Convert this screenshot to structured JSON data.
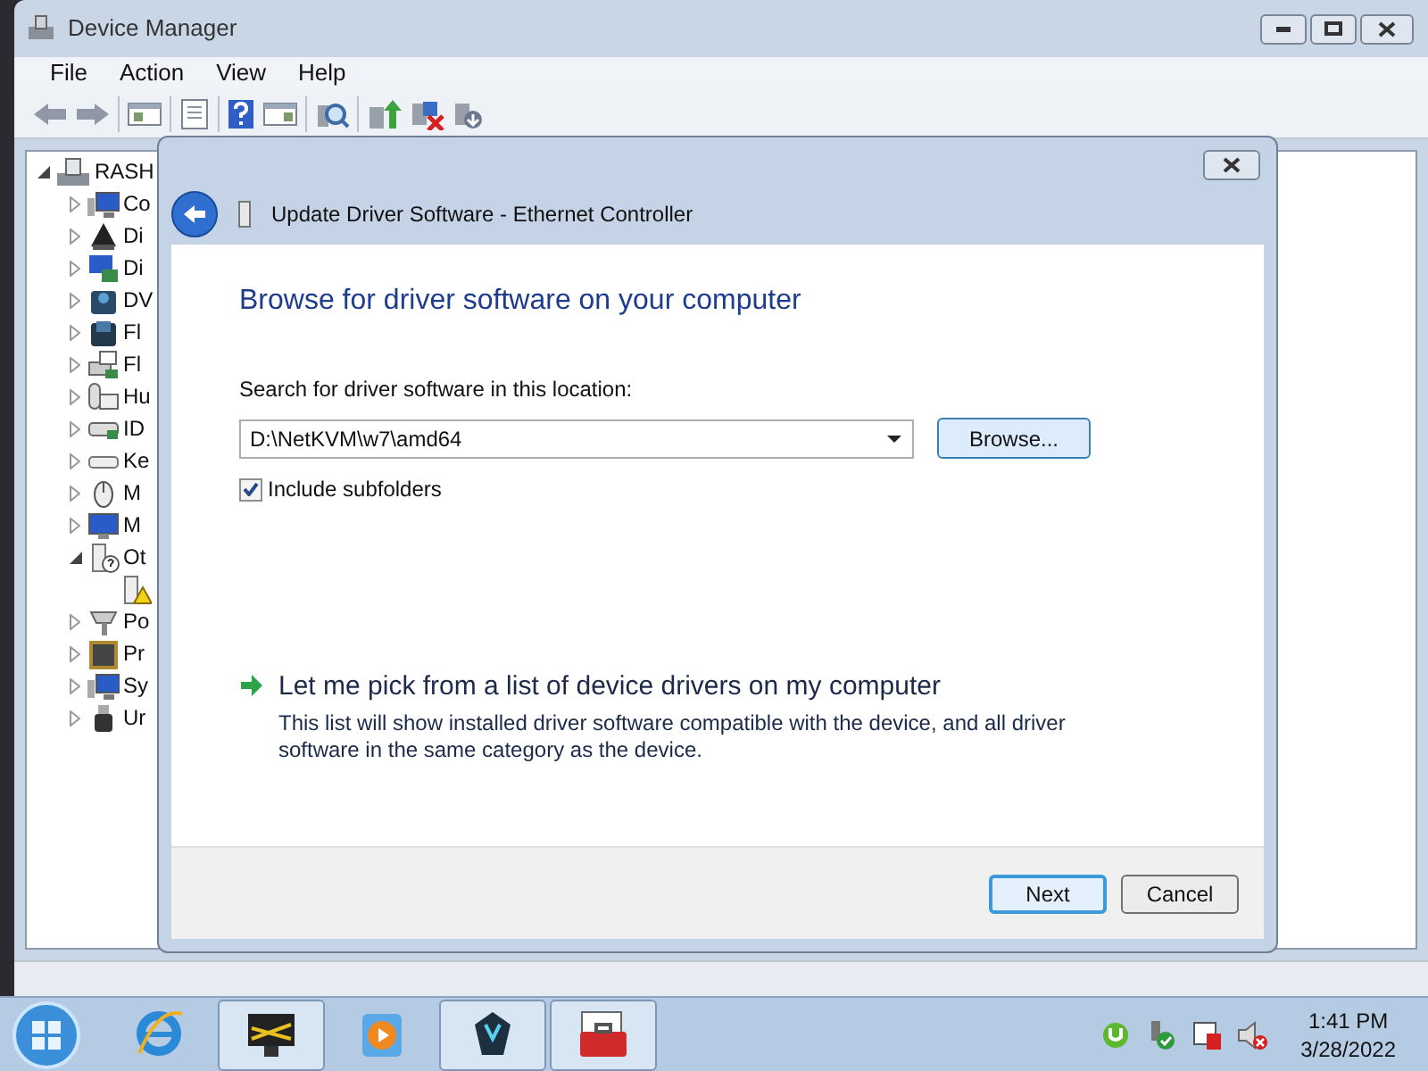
{
  "window": {
    "title": "Device Manager"
  },
  "menu": [
    "File",
    "Action",
    "View",
    "Help"
  ],
  "tree": {
    "label": "RASH",
    "expanded": true,
    "children": [
      {
        "label": "Co",
        "kind": "computer",
        "expanded": false
      },
      {
        "label": "Di",
        "kind": "disk",
        "expanded": false
      },
      {
        "label": "Di",
        "kind": "display",
        "expanded": false
      },
      {
        "label": "DV",
        "kind": "dvd",
        "expanded": false
      },
      {
        "label": "Fl",
        "kind": "floppy",
        "expanded": false
      },
      {
        "label": "Fl",
        "kind": "controller",
        "expanded": false
      },
      {
        "label": "Hu",
        "kind": "hid",
        "expanded": false
      },
      {
        "label": "ID",
        "kind": "ide",
        "expanded": false
      },
      {
        "label": "Ke",
        "kind": "keyboard",
        "expanded": false
      },
      {
        "label": "M",
        "kind": "mouse",
        "expanded": false
      },
      {
        "label": "M",
        "kind": "monitor",
        "expanded": false
      },
      {
        "label": "Ot",
        "kind": "other",
        "expanded": true,
        "children": [
          {
            "kind": "warning"
          }
        ]
      },
      {
        "label": "Po",
        "kind": "port",
        "expanded": false
      },
      {
        "label": "Pr",
        "kind": "cpu",
        "expanded": false
      },
      {
        "label": "Sy",
        "kind": "computer",
        "expanded": false
      },
      {
        "label": "Ur",
        "kind": "usb",
        "expanded": false
      }
    ]
  },
  "dialog": {
    "title": "Update Driver Software - Ethernet Controller",
    "heading": "Browse for driver software on your computer",
    "location_label": "Search for driver software in this location:",
    "location_value": "D:\\NetKVM\\w7\\amd64",
    "browse_button": "Browse...",
    "include_subfolders": {
      "label": "Include subfolders",
      "checked": true
    },
    "pick_link": {
      "title": "Let me pick from a list of device drivers on my computer",
      "description": "This list will show installed driver software compatible with the device, and all driver software in the same category as the device."
    },
    "buttons": [
      {
        "label": "Next",
        "default": true
      },
      {
        "label": "Cancel",
        "default": false
      }
    ]
  },
  "taskbar": {
    "items": [
      {
        "kind": "browser",
        "open": false
      },
      {
        "kind": "monitor",
        "open": true
      },
      {
        "kind": "media",
        "open": false
      },
      {
        "kind": "app",
        "open": true
      },
      {
        "kind": "toolbox",
        "open": true
      }
    ],
    "time": "1:41 PM",
    "date": "3/28/2022"
  }
}
